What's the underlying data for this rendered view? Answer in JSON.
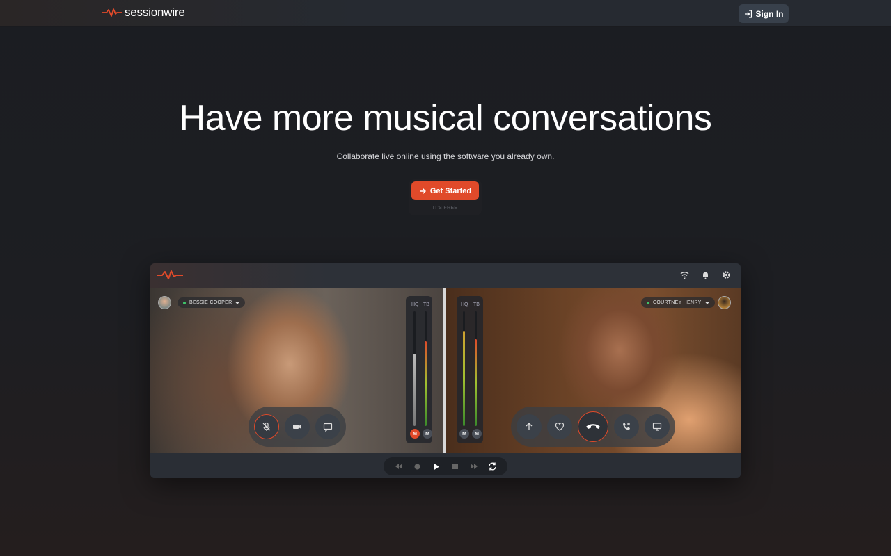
{
  "header": {
    "brand": "sessionwire",
    "signin_label": "Sign In"
  },
  "hero": {
    "title": "Have more musical conversations",
    "subtitle": "Collaborate live online using the software you already own.",
    "cta_label": "Get Started",
    "cta_note": "IT'S FREE"
  },
  "app": {
    "left_participant": "BESSIE COOPER",
    "right_participant": "COURTNEY HENRY",
    "meter_labels": [
      "HQ",
      "TB"
    ],
    "mute_labels": [
      "M",
      "M"
    ],
    "left_meter_levels": [
      0.63,
      0.74
    ],
    "right_meter_levels": [
      0.83,
      0.76
    ]
  },
  "colors": {
    "accent": "#e04a2a",
    "status_online": "#3fc46a"
  }
}
